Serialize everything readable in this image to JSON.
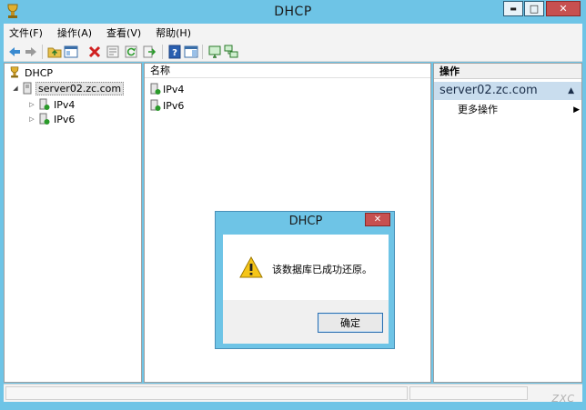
{
  "window": {
    "title": "DHCP"
  },
  "titlebar_buttons": {
    "minimize": "▬",
    "maximize": "□",
    "close": "✕"
  },
  "menu": [
    "文件(F)",
    "操作(A)",
    "查看(V)",
    "帮助(H)"
  ],
  "toolbar": {
    "icons": [
      "back-icon",
      "forward-icon",
      "up-folder-icon",
      "console-tree-icon",
      "delete-icon",
      "properties-icon",
      "refresh-icon",
      "export-icon",
      "help-icon",
      "action-pane-icon",
      "monitor-icon",
      "network-icon"
    ]
  },
  "tree": {
    "root": "DHCP",
    "server": "server02.zc.com",
    "children": [
      "IPv4",
      "IPv6"
    ]
  },
  "list": {
    "column_name": "名称",
    "rows": [
      "IPv4",
      "IPv6"
    ]
  },
  "actions": {
    "header": "操作",
    "server": "server02.zc.com",
    "more": "更多操作"
  },
  "dialog": {
    "title": "DHCP",
    "message": "该数据库已成功还原。",
    "ok": "确定"
  },
  "watermark": "ZXC",
  "colors": {
    "titlebar": "#6ec4e6",
    "close": "#c75050",
    "selection": "#c9ddee"
  }
}
